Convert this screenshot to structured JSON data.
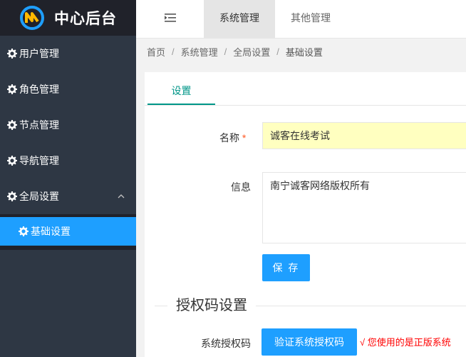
{
  "brand": {
    "title": "中心后台",
    "logo_icon": "brand-logo-icon"
  },
  "sidebar": {
    "items": [
      {
        "label": "用户管理",
        "icon": "gear-icon"
      },
      {
        "label": "角色管理",
        "icon": "gear-icon"
      },
      {
        "label": "节点管理",
        "icon": "gear-icon"
      },
      {
        "label": "导航管理",
        "icon": "gear-icon"
      },
      {
        "label": "全局设置",
        "icon": "gear-icon",
        "expanded": true
      }
    ],
    "submenu": [
      {
        "label": "基础设置",
        "icon": "gear-icon",
        "active": true
      }
    ]
  },
  "topbar": {
    "toggle_icon": "menu-fold-icon",
    "tabs": [
      {
        "label": "系统管理",
        "active": true
      },
      {
        "label": "其他管理"
      }
    ]
  },
  "breadcrumb": {
    "items": [
      "首页",
      "系统管理",
      "全局设置",
      "基础设置"
    ],
    "separator": "/"
  },
  "content": {
    "tab": "设置",
    "name": {
      "label": "名称",
      "required_mark": "*",
      "value": "诚客在线考试"
    },
    "info": {
      "label": "信息",
      "value": "南宁诚客网络版权所有"
    },
    "save_label": "保 存",
    "section_title": "授权码设置",
    "auth": {
      "label": "系统授权码",
      "verify_label": "验证系统授权码",
      "status": "√ 您使用的是正版系统"
    }
  },
  "colors": {
    "sidebar": "#2e3744",
    "brand_bg": "#20222a",
    "accent": "#1e9fff",
    "tab_accent": "#009688",
    "status": "#ff0000"
  }
}
